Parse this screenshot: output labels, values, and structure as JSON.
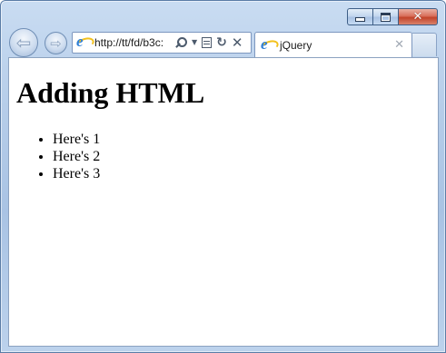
{
  "browser": {
    "address_url": "http://tt/fd/b3c:",
    "tab_title": "jQuery",
    "tab_close_glyph": "✕",
    "colors": {
      "frame": "#b6cde9",
      "close_button": "#c2432a",
      "ie_blue": "#2e7fd6",
      "ie_ring": "#f3c11c"
    },
    "icons": [
      "back-arrow-icon",
      "forward-arrow-icon",
      "ie-logo-icon",
      "search-icon",
      "dropdown-chevron-icon",
      "compatibility-view-icon",
      "refresh-icon",
      "stop-icon",
      "tab-close-icon",
      "minimize-icon",
      "maximize-icon",
      "close-icon"
    ]
  },
  "page": {
    "heading": "Adding HTML",
    "items": [
      "Here's 1",
      "Here's 2",
      "Here's 3"
    ]
  }
}
